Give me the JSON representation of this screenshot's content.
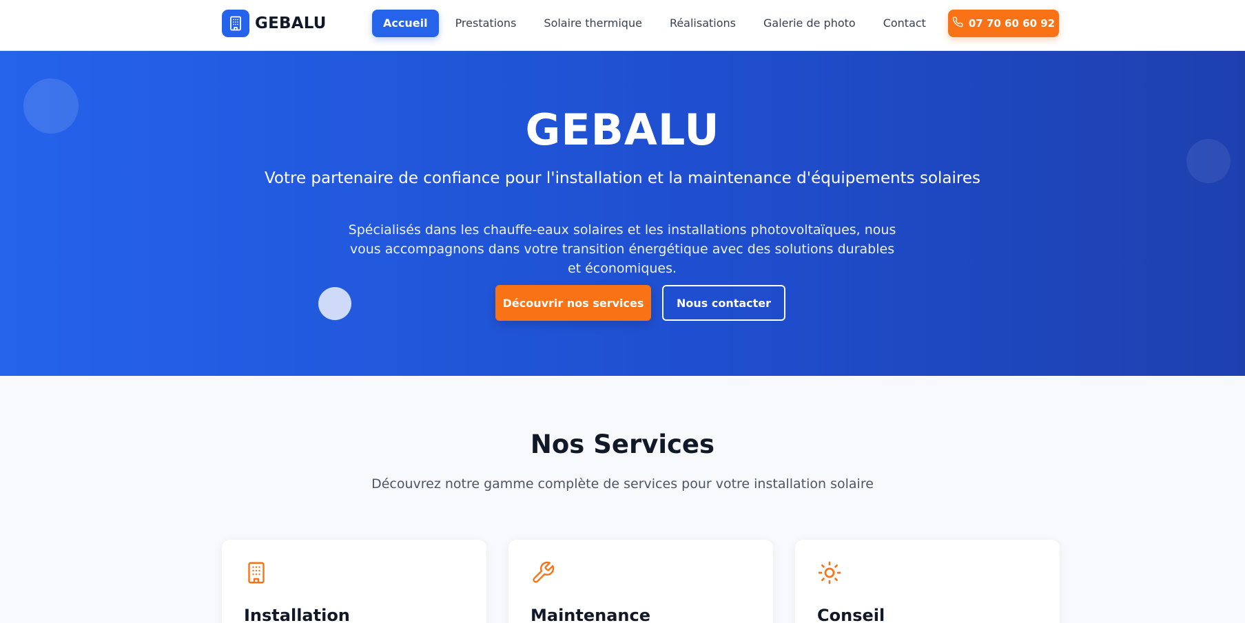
{
  "brand": {
    "name": "GEBALU",
    "logo_icon": "building-icon",
    "accent": "#2563eb"
  },
  "nav": {
    "items": [
      {
        "label": "Accueil",
        "active": true
      },
      {
        "label": "Prestations",
        "active": false
      },
      {
        "label": "Solaire thermique",
        "active": false
      },
      {
        "label": "Réalisations",
        "active": false
      },
      {
        "label": "Galerie de photo",
        "active": false
      },
      {
        "label": "Contact",
        "active": false
      }
    ],
    "phone": {
      "label": "07 70 60 60 92",
      "icon": "phone-icon",
      "color": "#f97316"
    }
  },
  "hero": {
    "title": "GEBALU",
    "subtitle": "Votre partenaire de confiance pour l'installation et la maintenance d'équipements solaires",
    "description": "Spécialisés dans les chauffe-eaux solaires et les installations photovoltaïques, nous vous accompagnons dans votre transition énergétique avec des solutions durables et économiques.",
    "primary_button": "Découvrir nos services",
    "secondary_button": "Nous contacter"
  },
  "services": {
    "title": "Nos Services",
    "subtitle": "Découvrez notre gamme complète de services pour votre installation solaire",
    "cards": [
      {
        "title": "Installation",
        "icon": "building-icon"
      },
      {
        "title": "Maintenance",
        "icon": "wrench-icon"
      },
      {
        "title": "Conseil",
        "icon": "sun-icon"
      }
    ]
  }
}
